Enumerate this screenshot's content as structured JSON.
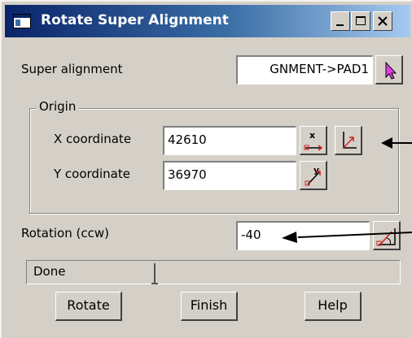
{
  "window": {
    "title": "Rotate Super Alignment",
    "icons": [
      "app-window-icon",
      "minimize-icon",
      "maximize-icon",
      "close-icon"
    ]
  },
  "super_alignment": {
    "label": "Super alignment",
    "value": "GNMENT->PAD1",
    "pick_icon": "cursor-pick-icon"
  },
  "origin": {
    "group_label": "Origin",
    "x_label": "X coordinate",
    "x_value": "42610",
    "y_label": "Y coordinate",
    "y_value": "36970",
    "pick_icon": "xy-pick-icon"
  },
  "rotation": {
    "label": "Rotation (ccw)",
    "value": "-40",
    "pick_icon": "angle-pick-icon"
  },
  "status": {
    "text": "Done"
  },
  "buttons": {
    "rotate": "Rotate",
    "finish": "Finish",
    "help": "Help"
  },
  "colors": {
    "title_start": "#0a246a",
    "title_end": "#a6caf0",
    "face": "#d4d0c8"
  }
}
